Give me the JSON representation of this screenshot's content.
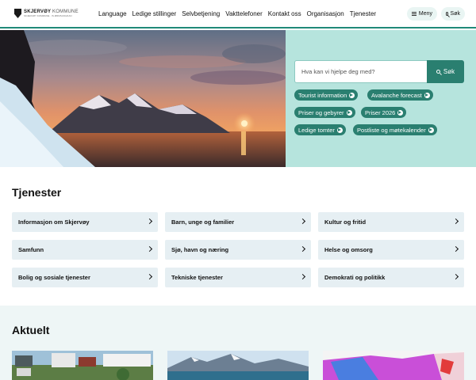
{
  "header": {
    "logo_name": "SKJERVØY",
    "logo_name_suffix": "KOMMUNE",
    "logo_sub": "SKJERVØY KOMMUNE · IS ØRMSUOHKAN",
    "nav": [
      "Language",
      "Ledige stillinger",
      "Selvbetjening",
      "Vakttelefoner",
      "Kontakt oss",
      "Organisasjon",
      "Tjenester"
    ],
    "menu_label": "Meny",
    "search_label": "Søk"
  },
  "hero": {
    "search_placeholder": "Hva kan vi hjelpe deg med?",
    "search_button": "Søk",
    "quick_links": [
      "Tourist information",
      "Avalanche forecast",
      "Priser og gebyrer",
      "Priser 2026",
      "Ledige tomter",
      "Postliste og møtekalender"
    ]
  },
  "services": {
    "title": "Tjenester",
    "items": [
      "Informasjon om Skjervøy",
      "Barn, unge og familier",
      "Kultur og fritid",
      "Samfunn",
      "Sjø, havn og næring",
      "Helse og omsorg",
      "Bolig og sosiale tjenester",
      "Tekniske tjenester",
      "Demokrati og politikk"
    ]
  },
  "news": {
    "title": "Aktuelt"
  },
  "colors": {
    "accent": "#2a7f70",
    "panel": "#b6e4dd",
    "card": "#e6eff3"
  }
}
